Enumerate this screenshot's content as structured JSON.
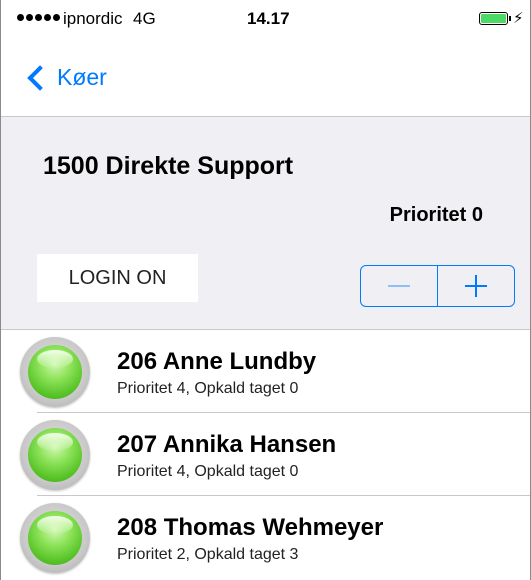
{
  "status_bar": {
    "carrier": "ipnordic",
    "network": "4G",
    "time": "14.17"
  },
  "nav": {
    "back_label": "Køer"
  },
  "queue": {
    "title": "1500 Direkte Support",
    "priority_label": "Prioritet 0",
    "login_button_label": "LOGIN ON"
  },
  "agents": [
    {
      "name": "206 Anne Lundby",
      "detail": "Prioritet 4, Opkald taget 0",
      "status_color": "green"
    },
    {
      "name": "207 Annika Hansen",
      "detail": "Prioritet 4, Opkald taget 0",
      "status_color": "green"
    },
    {
      "name": "208 Thomas Wehmeyer",
      "detail": "Prioritet 2, Opkald taget 3",
      "status_color": "green"
    }
  ],
  "colors": {
    "accent": "#007aff",
    "panel_bg": "#efeff4",
    "status_green": "#58c428"
  }
}
